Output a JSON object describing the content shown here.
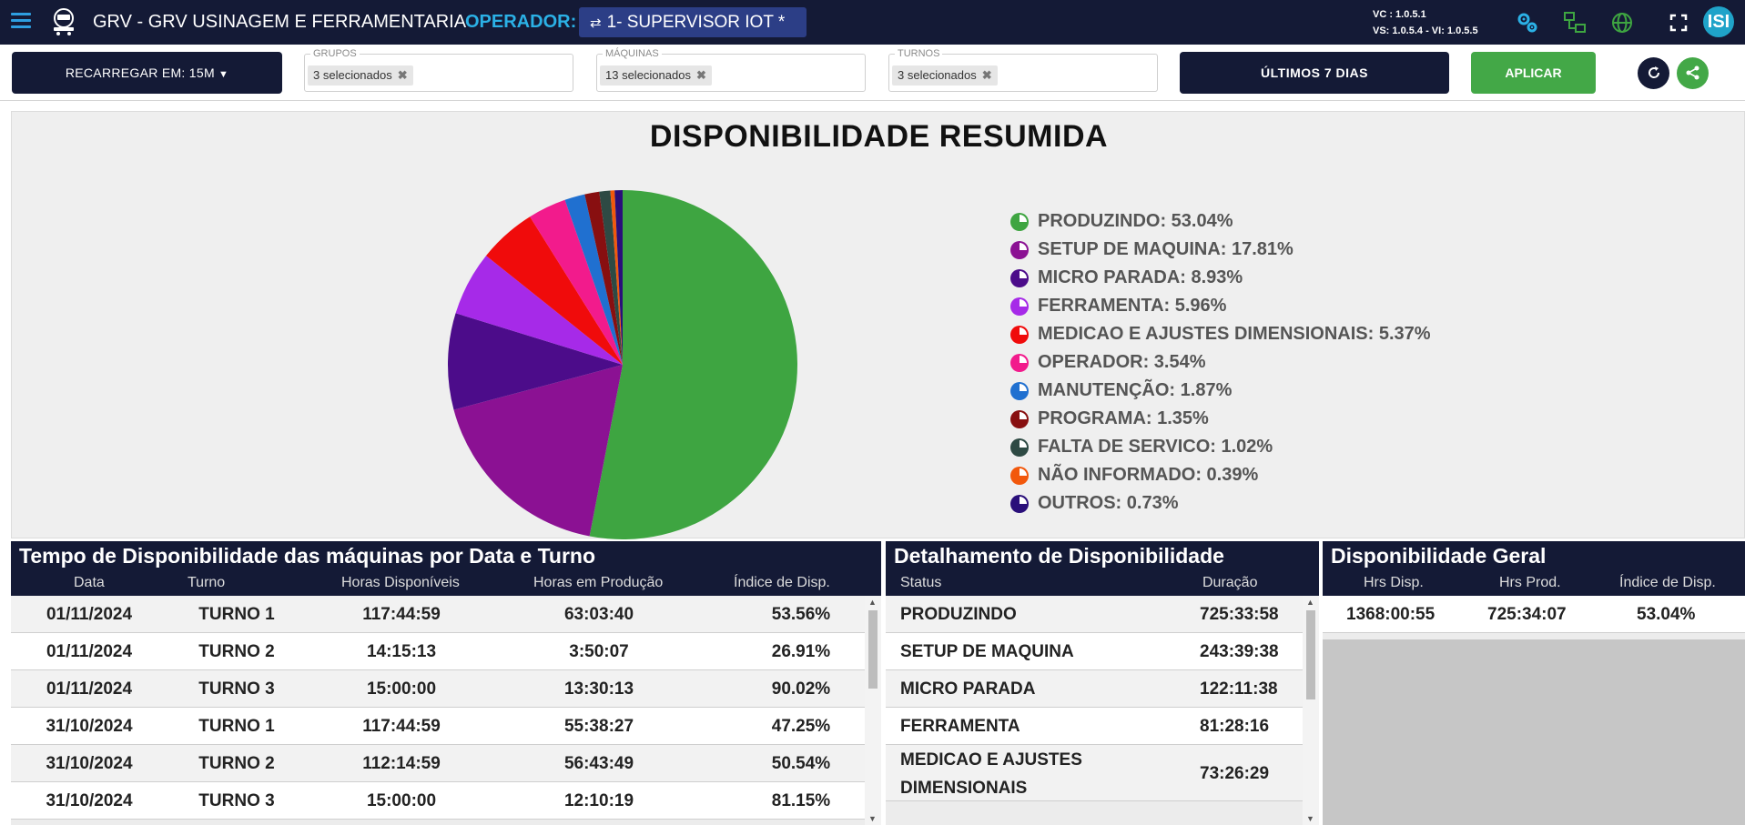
{
  "header": {
    "title": "GRV - GRV USINAGEM E FERRAMENTARIA",
    "operator_label": "OPERADOR:",
    "operator_value": "1- SUPERVISOR IOT *",
    "version_vc": "VC : 1.0.5.1",
    "version_vs": "VS: 1.0.5.4 - VI: 1.0.5.5",
    "avatar": "ISI"
  },
  "filters": {
    "reload_label": "RECARREGAR EM: 15M",
    "groups": {
      "legend": "GRUPOS",
      "value": "3 selecionados"
    },
    "machines": {
      "legend": "MÁQUINAS",
      "value": "13 selecionados"
    },
    "shifts": {
      "legend": "TURNOS",
      "value": "3 selecionados"
    },
    "period_label": "ÚLTIMOS 7 DIAS",
    "apply_label": "APLICAR"
  },
  "chart_data": {
    "type": "pie",
    "title": "DISPONIBILIDADE RESUMIDA",
    "legend_position": "right",
    "slices": [
      {
        "label": "PRODUZINDO",
        "value": 53.04,
        "display": "PRODUZINDO: 53.04%",
        "color": "#3ea541"
      },
      {
        "label": "SETUP DE MAQUINA",
        "value": 17.81,
        "display": "SETUP DE MAQUINA: 17.81%",
        "color": "#8b1193"
      },
      {
        "label": "MICRO PARADA",
        "value": 8.93,
        "display": "MICRO PARADA: 8.93%",
        "color": "#4c0c8a"
      },
      {
        "label": "FERRAMENTA",
        "value": 5.96,
        "display": "FERRAMENTA: 5.96%",
        "color": "#a62ae8"
      },
      {
        "label": "MEDICAO E AJUSTES DIMENSIONAIS",
        "value": 5.37,
        "display": "MEDICAO E AJUSTES DIMENSIONAIS: 5.37%",
        "color": "#f00b0b"
      },
      {
        "label": "OPERADOR",
        "value": 3.54,
        "display": "OPERADOR: 3.54%",
        "color": "#f21b8c"
      },
      {
        "label": "MANUTENÇÃO",
        "value": 1.87,
        "display": "MANUTENÇÃO: 1.87%",
        "color": "#2070d0"
      },
      {
        "label": "PROGRAMA",
        "value": 1.35,
        "display": "PROGRAMA: 1.35%",
        "color": "#880f10"
      },
      {
        "label": "FALTA DE SERVICO",
        "value": 1.02,
        "display": "FALTA DE SERVICO: 1.02%",
        "color": "#2e4a44"
      },
      {
        "label": "NÃO INFORMADO",
        "value": 0.39,
        "display": "NÃO INFORMADO: 0.39%",
        "color": "#f2580c"
      },
      {
        "label": "OUTROS",
        "value": 0.73,
        "display": "OUTROS: 0.73%",
        "color": "#2a0f7a"
      }
    ]
  },
  "time_table": {
    "title": "Tempo de Disponibilidade das máquinas por Data e Turno",
    "columns": [
      "Data",
      "Turno",
      "Horas Disponíveis",
      "Horas em Produção",
      "Índice de Disp."
    ],
    "rows": [
      [
        "01/11/2024",
        "TURNO 1",
        "117:44:59",
        "63:03:40",
        "53.56%"
      ],
      [
        "01/11/2024",
        "TURNO 2",
        "14:15:13",
        "3:50:07",
        "26.91%"
      ],
      [
        "01/11/2024",
        "TURNO 3",
        "15:00:00",
        "13:30:13",
        "90.02%"
      ],
      [
        "31/10/2024",
        "TURNO 1",
        "117:44:59",
        "55:38:27",
        "47.25%"
      ],
      [
        "31/10/2024",
        "TURNO 2",
        "112:14:59",
        "56:43:49",
        "50.54%"
      ],
      [
        "31/10/2024",
        "TURNO 3",
        "15:00:00",
        "12:10:19",
        "81.15%"
      ]
    ]
  },
  "detail_table": {
    "title": "Detalhamento de Disponibilidade",
    "columns": [
      "Status",
      "Duração"
    ],
    "rows": [
      [
        "PRODUZINDO",
        "725:33:58"
      ],
      [
        "SETUP DE MAQUINA",
        "243:39:38"
      ],
      [
        "MICRO PARADA",
        "122:11:38"
      ],
      [
        "FERRAMENTA",
        "81:28:16"
      ],
      [
        "MEDICAO E AJUSTES",
        "DIMENSIONAIS",
        "73:26:29"
      ]
    ]
  },
  "general_table": {
    "title": "Disponibilidade Geral",
    "columns": [
      "Hrs Disp.",
      "Hrs Prod.",
      "Índice de Disp."
    ],
    "row": [
      "1368:00:55",
      "725:34:07",
      "53.04%"
    ]
  }
}
